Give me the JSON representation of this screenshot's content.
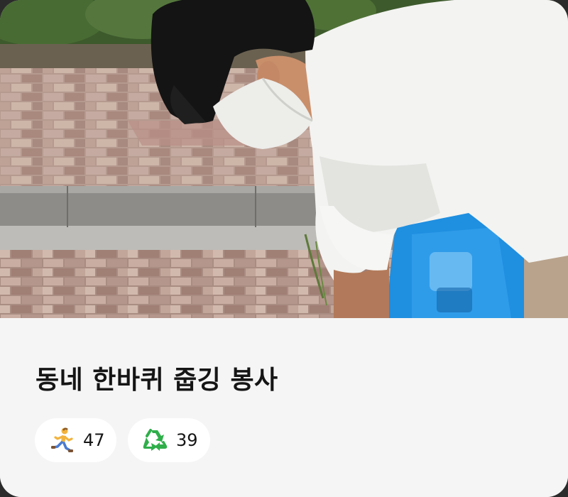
{
  "card": {
    "photo": {
      "alt": "Volunteer picking up litter on a brick sidewalk"
    },
    "title": "동네 한바퀴 줍깅 봉사",
    "stats": [
      {
        "icon": "runner-icon",
        "value": "47"
      },
      {
        "icon": "recycle-icon",
        "value": "39"
      }
    ]
  },
  "colors": {
    "card_background": "#f5f5f5",
    "badge_background": "#ffffff",
    "title_text": "#151515",
    "recycle_green": "#2fae4a"
  }
}
